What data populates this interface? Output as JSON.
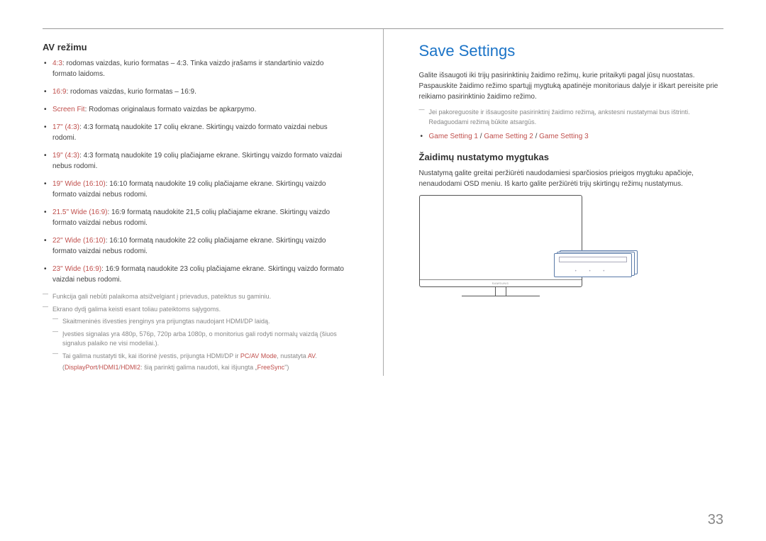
{
  "left": {
    "heading": "AV režimu",
    "bullets": [
      {
        "term": "4:3",
        "text": ": rodomas vaizdas, kurio formatas – 4:3. Tinka vaizdo įrašams ir standartinio vaizdo formato laidoms."
      },
      {
        "term": "16:9",
        "text": ": rodomas vaizdas, kurio formatas – 16:9."
      },
      {
        "term": "Screen Fit",
        "text": ": Rodomas originalaus formato vaizdas be apkarpymo."
      },
      {
        "term": "17\" (4:3)",
        "text": ": 4:3 formatą naudokite 17 colių ekrane. Skirtingų vaizdo formato vaizdai nebus rodomi."
      },
      {
        "term": "19\" (4:3)",
        "text": ": 4:3 formatą naudokite 19 colių plačiajame ekrane. Skirtingų vaizdo formato vaizdai nebus rodomi."
      },
      {
        "term": "19\" Wide (16:10)",
        "text": ": 16:10 formatą naudokite 19 colių plačiajame ekrane. Skirtingų vaizdo formato vaizdai nebus rodomi."
      },
      {
        "term": "21.5\" Wide (16:9)",
        "text": ": 16:9 formatą naudokite 21,5 colių plačiajame ekrane. Skirtingų vaizdo formato vaizdai nebus rodomi."
      },
      {
        "term": "22\" Wide (16:10)",
        "text": ": 16:10 formatą naudokite 22 colių plačiajame ekrane. Skirtingų vaizdo formato vaizdai nebus rodomi."
      },
      {
        "term": "23\" Wide (16:9)",
        "text": ": 16:9 formatą naudokite 23 colių plačiajame ekrane. Skirtingų vaizdo formato vaizdai nebus rodomi."
      }
    ],
    "notes": [
      "Funkcija gali nebūti palaikoma atsižvelgiant į prievadus, pateiktus su gaminiu.",
      "Ekrano dydį galima keisti esant toliau pateiktoms sąlygoms."
    ],
    "subnotes": [
      "Skaitmeninės išvesties įrenginys yra prijungtas naudojant HDMI/DP laidą.",
      "Įvesties signalas yra 480p, 576p, 720p arba 1080p, o monitorius gali rodyti normalų vaizdą (šiuos signalus palaiko ne visi modeliai.)."
    ],
    "subnote3_pre": "Tai galima nustatyti tik, kai išorinė įvestis, prijungta HDMI/DP ir ",
    "subnote3_term1": "PC/AV Mode",
    "subnote3_mid": ", nustatyta ",
    "subnote3_term2": "AV",
    "subnote3_post": ".",
    "subnote4_pre": "(",
    "subnote4_t1": "DisplayPort",
    "subnote4_s1": "/",
    "subnote4_t2": "HDMI1",
    "subnote4_s2": "/",
    "subnote4_t3": "HDMI2",
    "subnote4_mid": ": šią parinktį galima naudoti, kai išjungta „",
    "subnote4_t4": "FreeSync",
    "subnote4_post": "\")"
  },
  "right": {
    "title": "Save Settings",
    "para1": "Galite išsaugoti iki trijų pasirinktinių žaidimo režimų, kurie pritaikyti pagal jūsų nuostatas. Paspauskite žaidimo režimo spartųjį mygtuką apatinėje monitoriaus dalyje ir iškart pereisite prie reikiamo pasirinktinio žaidimo režimo.",
    "note1": "Jei pakoreguosite ir išsaugosite pasirinktinį žaidimo režimą, ankstesni nustatymai bus ištrinti. Redaguodami režimą būkite atsargūs.",
    "gs1": "Game Setting 1",
    "sep": " / ",
    "gs2": "Game Setting 2",
    "gs3": "Game Setting 3",
    "heading2": "Žaidimų nustatymo mygtukas",
    "para2": "Nustatymą galite greitai peržiūrėti naudodamiesi sparčiosios prieigos mygtuku apačioje, nenaudodami OSD meniu. Iš karto galite peržiūrėti trijų skirtingų režimų nustatymus."
  },
  "page_number": "33"
}
